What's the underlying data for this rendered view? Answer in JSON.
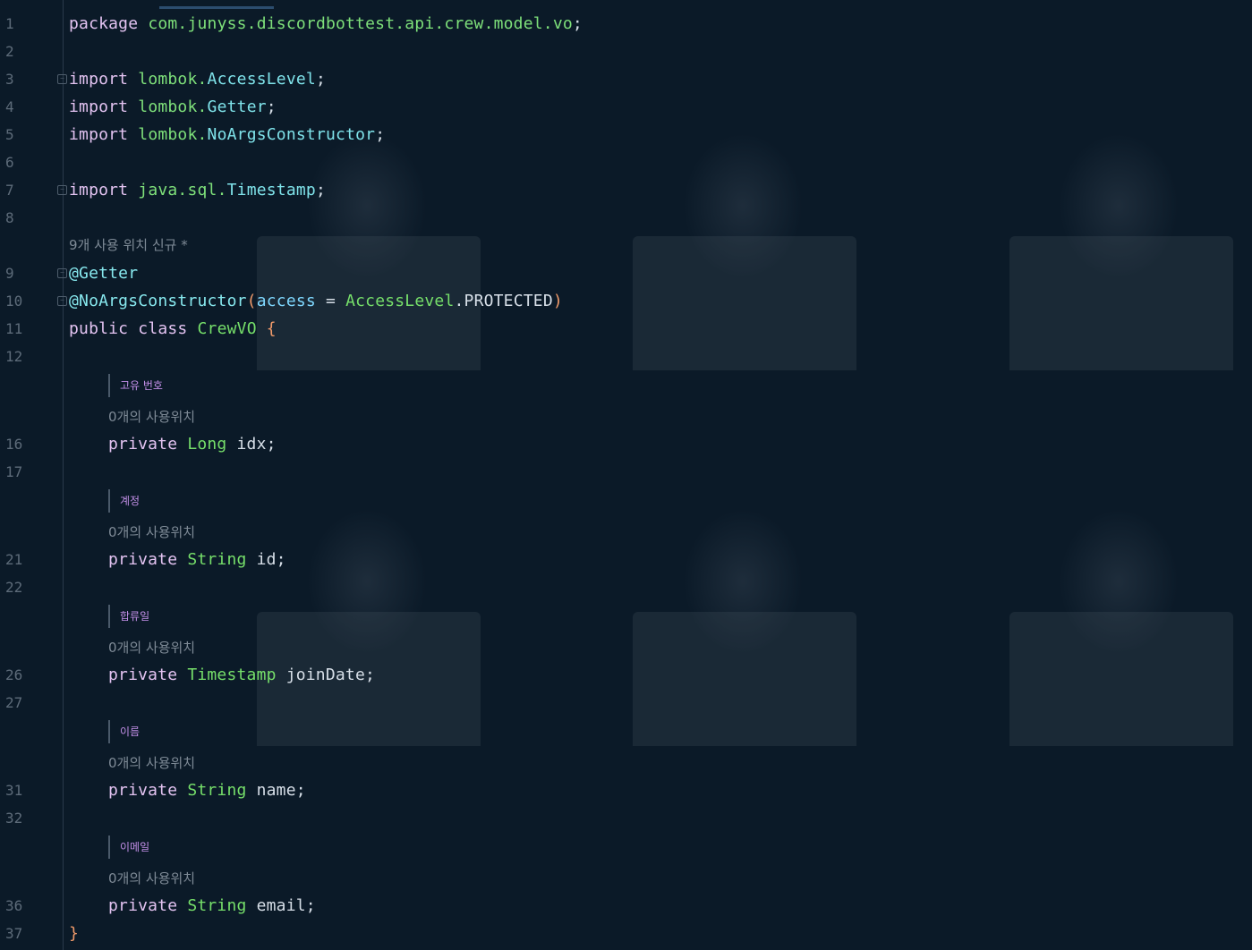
{
  "editor": {
    "lines": [
      {
        "num": "1",
        "parts": [
          [
            "kw",
            "package"
          ],
          [
            "id",
            " "
          ],
          [
            "pkg",
            "com.junyss.discordbottest.api.crew.model.vo"
          ],
          [
            "id",
            ";"
          ]
        ]
      },
      {
        "num": "2",
        "parts": []
      },
      {
        "num": "3",
        "parts": [
          [
            "kw",
            "import"
          ],
          [
            "id",
            " "
          ],
          [
            "pkg",
            "lombok."
          ],
          [
            "cls",
            "AccessLevel"
          ],
          [
            "id",
            ";"
          ]
        ]
      },
      {
        "num": "4",
        "parts": [
          [
            "kw",
            "import"
          ],
          [
            "id",
            " "
          ],
          [
            "pkg",
            "lombok."
          ],
          [
            "cls",
            "Getter"
          ],
          [
            "id",
            ";"
          ]
        ]
      },
      {
        "num": "5",
        "parts": [
          [
            "kw",
            "import"
          ],
          [
            "id",
            " "
          ],
          [
            "pkg",
            "lombok."
          ],
          [
            "cls",
            "NoArgsConstructor"
          ],
          [
            "id",
            ";"
          ]
        ]
      },
      {
        "num": "6",
        "parts": []
      },
      {
        "num": "7",
        "parts": [
          [
            "kw",
            "import"
          ],
          [
            "id",
            " "
          ],
          [
            "pkg",
            "java.sql."
          ],
          [
            "cls",
            "Timestamp"
          ],
          [
            "id",
            ";"
          ]
        ]
      },
      {
        "num": "8",
        "parts": []
      },
      {
        "num": "9",
        "parts": [
          [
            "ann",
            "@Getter"
          ]
        ]
      },
      {
        "num": "10",
        "parts": [
          [
            "ann",
            "@NoArgsConstructor"
          ],
          [
            "brace",
            "("
          ],
          [
            "param",
            "access"
          ],
          [
            "op",
            " = "
          ],
          [
            "type",
            "AccessLevel"
          ],
          [
            "id",
            "."
          ],
          [
            "id",
            "PROTECTED"
          ],
          [
            "brace",
            ")"
          ]
        ]
      },
      {
        "num": "11",
        "parts": [
          [
            "kw",
            "public"
          ],
          [
            "id",
            " "
          ],
          [
            "kw",
            "class"
          ],
          [
            "id",
            " "
          ],
          [
            "type",
            "CrewVO"
          ],
          [
            "id",
            " "
          ],
          [
            "brace",
            "{"
          ]
        ]
      },
      {
        "num": "12",
        "parts": []
      },
      {
        "num": "16",
        "parts": [
          [
            "kw",
            "private"
          ],
          [
            "id",
            " "
          ],
          [
            "type",
            "Long"
          ],
          [
            "id",
            " idx;"
          ]
        ]
      },
      {
        "num": "17",
        "parts": []
      },
      {
        "num": "21",
        "parts": [
          [
            "kw",
            "private"
          ],
          [
            "id",
            " "
          ],
          [
            "type",
            "String"
          ],
          [
            "id",
            " id;"
          ]
        ]
      },
      {
        "num": "22",
        "parts": []
      },
      {
        "num": "26",
        "parts": [
          [
            "kw",
            "private"
          ],
          [
            "id",
            " "
          ],
          [
            "type",
            "Timestamp"
          ],
          [
            "id",
            " joinDate;"
          ]
        ]
      },
      {
        "num": "27",
        "parts": []
      },
      {
        "num": "31",
        "parts": [
          [
            "kw",
            "private"
          ],
          [
            "id",
            " "
          ],
          [
            "type",
            "String"
          ],
          [
            "id",
            " name;"
          ]
        ]
      },
      {
        "num": "32",
        "parts": []
      },
      {
        "num": "36",
        "parts": [
          [
            "kw",
            "private"
          ],
          [
            "id",
            " "
          ],
          [
            "type",
            "String"
          ],
          [
            "id",
            " email;"
          ]
        ]
      },
      {
        "num": "37",
        "parts": [
          [
            "brace",
            "}"
          ]
        ]
      }
    ],
    "class_usage_hint": "9개 사용 위치   신규 *",
    "field_docs": [
      {
        "doc": "고유 번호",
        "usage": "0개의 사용위치"
      },
      {
        "doc": "계정",
        "usage": "0개의 사용위치"
      },
      {
        "doc": "합류일",
        "usage": "0개의 사용위치"
      },
      {
        "doc": "이름",
        "usage": "0개의 사용위치"
      },
      {
        "doc": "이메일",
        "usage": "0개의 사용위치"
      }
    ]
  }
}
